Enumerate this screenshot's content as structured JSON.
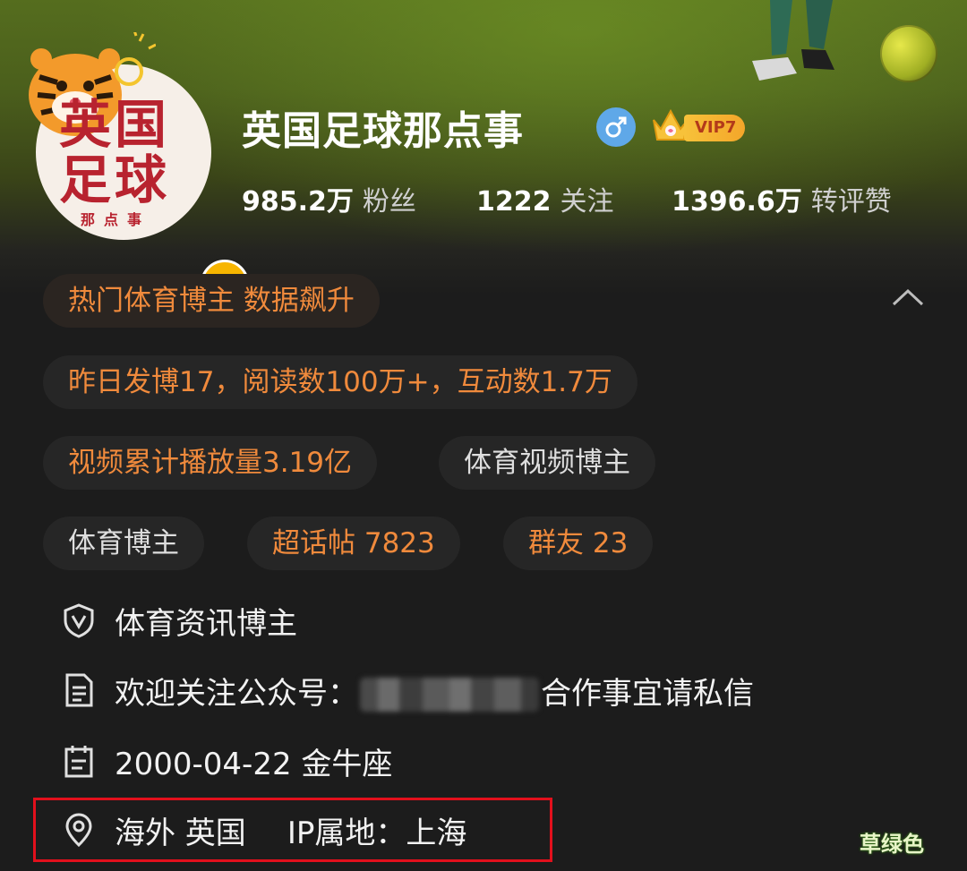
{
  "profile": {
    "name": "英国足球那点事",
    "vip_label": "VIP7",
    "avatar_text_line1": "英国",
    "avatar_text_line2": "足球",
    "avatar_sub": "那点事",
    "verified_badge": "V"
  },
  "stats": [
    {
      "value": "985.2万",
      "label": "粉丝"
    },
    {
      "value": "1222",
      "label": "关注"
    },
    {
      "value": "1396.6万",
      "label": "转评赞"
    }
  ],
  "tags": {
    "hot": "热门体育博主 数据飙升",
    "yesterday": "昨日发博17，阅读数100万+，互动数1.7万",
    "video_plays": "视频累计播放量3.19亿",
    "video_blogger": "体育视频博主",
    "sports_blogger": "体育博主",
    "super_topic": "超话帖 7823",
    "group_friends": "群友 23"
  },
  "info": {
    "verification": "体育资讯博主",
    "bio_prefix": "欢迎关注公众号：",
    "bio_suffix": "合作事宜请私信",
    "birthday": "2000-04-22 金牛座",
    "location": "海外 英国",
    "ip_location": "IP属地：上海"
  },
  "watermark": "草绿色",
  "colors": {
    "accent_orange": "#f08a3c",
    "highlight_red": "#e2101c",
    "vip_gold": "#f7c23a",
    "gender_blue": "#5fa8e8"
  },
  "icons": [
    "shield-v-icon",
    "document-icon",
    "calendar-icon",
    "location-pin-icon",
    "chevron-up-icon",
    "male-icon",
    "crown-icon"
  ]
}
